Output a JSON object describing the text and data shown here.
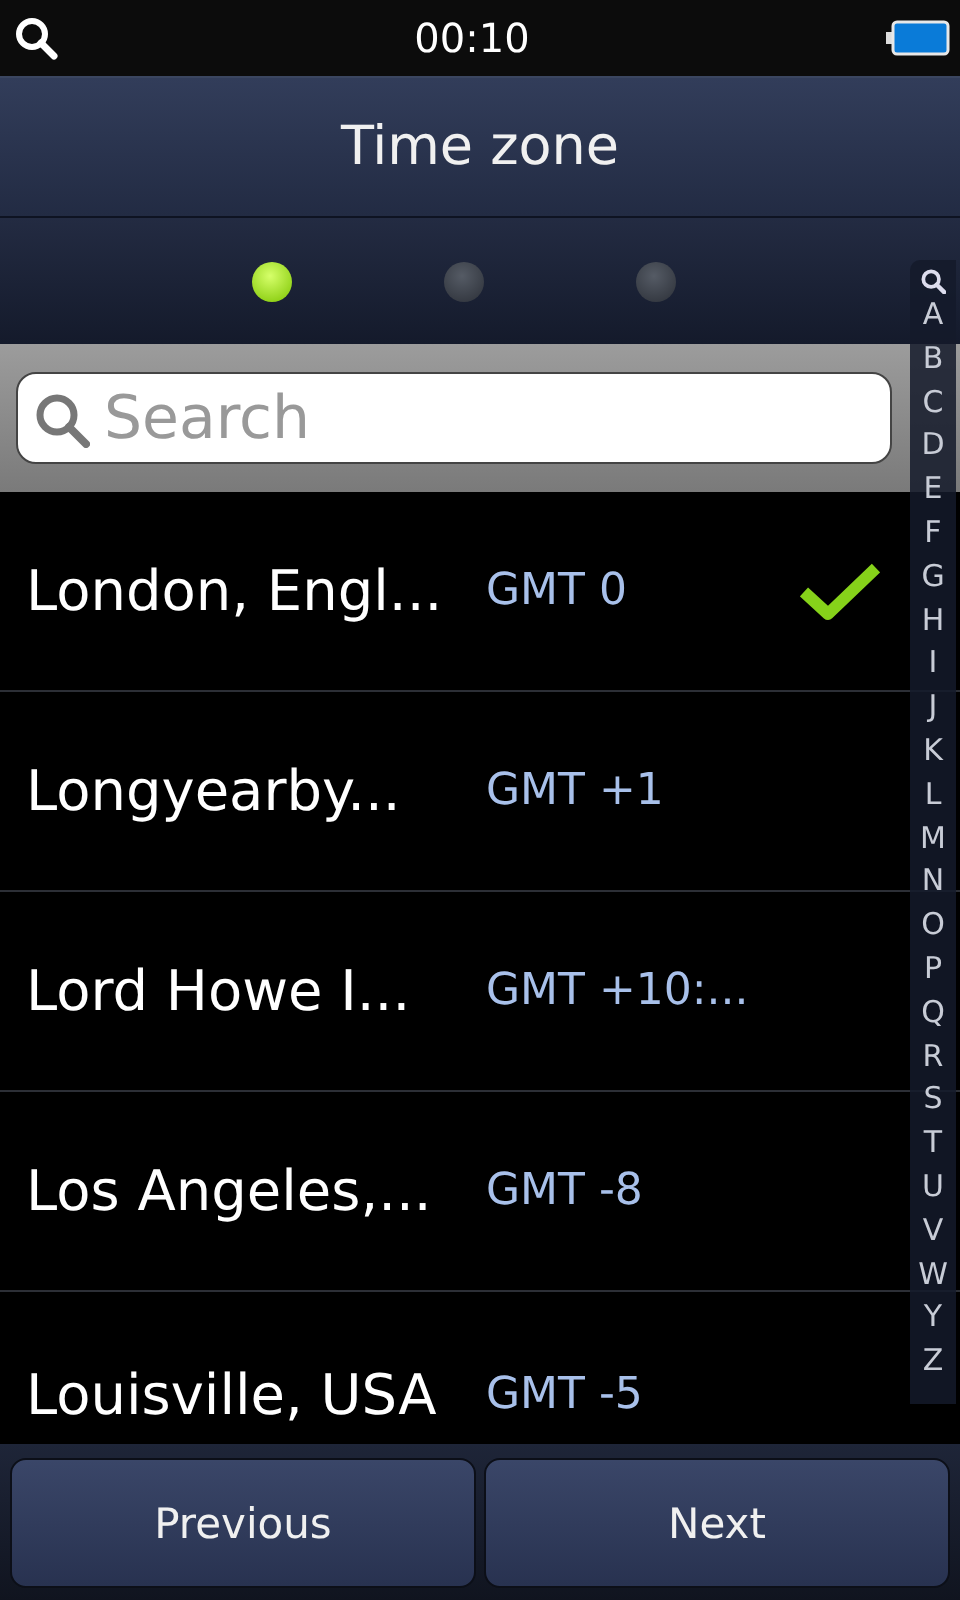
{
  "status_bar": {
    "time": "00:10"
  },
  "header": {
    "title": "Time zone"
  },
  "pages": [
    {
      "selected": true
    },
    {
      "selected": false
    },
    {
      "selected": false
    }
  ],
  "search": {
    "placeholder": "Search"
  },
  "index_letters": [
    "A",
    "B",
    "C",
    "D",
    "E",
    "F",
    "G",
    "H",
    "I",
    "J",
    "K",
    "L",
    "M",
    "N",
    "O",
    "P",
    "Q",
    "R",
    "S",
    "T",
    "U",
    "V",
    "W",
    "Y",
    "Z"
  ],
  "zones": [
    {
      "name": "London, Engl...",
      "offset": "GMT 0",
      "selected": true
    },
    {
      "name": "Longyearby...",
      "offset": "GMT +1",
      "selected": false
    },
    {
      "name": "Lord Howe I...",
      "offset": "GMT +10:...",
      "selected": false
    },
    {
      "name": "Los Angeles,...",
      "offset": "GMT -8",
      "selected": false
    },
    {
      "name": "Louisville, USA",
      "offset": "GMT -5",
      "selected": false
    }
  ],
  "buttons": [
    "Previous",
    "Next"
  ]
}
